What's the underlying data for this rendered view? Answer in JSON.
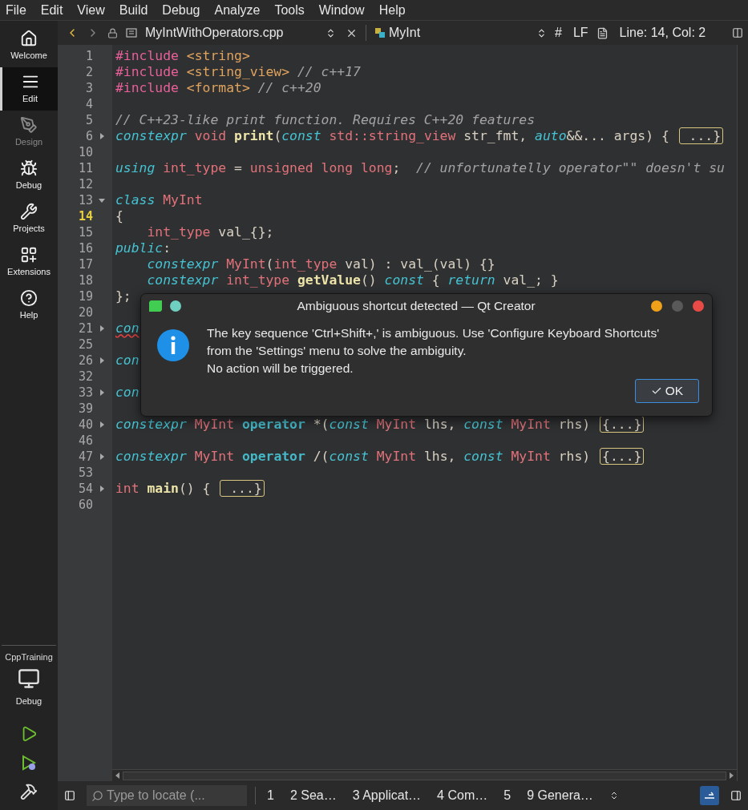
{
  "menu": [
    "File",
    "Edit",
    "View",
    "Build",
    "Debug",
    "Analyze",
    "Tools",
    "Window",
    "Help"
  ],
  "toolbar": {
    "file": "MyIntWithOperators.cpp",
    "symbol": "MyInt",
    "hash": "#",
    "line_ending": "LF",
    "position": "Line: 14, Col: 2"
  },
  "sidebar": {
    "modes": [
      {
        "label": "Welcome",
        "selected": false,
        "disabled": false
      },
      {
        "label": "Edit",
        "selected": true,
        "disabled": false
      },
      {
        "label": "Design",
        "selected": false,
        "disabled": true
      },
      {
        "label": "Debug",
        "selected": false,
        "disabled": false
      },
      {
        "label": "Projects",
        "selected": false,
        "disabled": false
      },
      {
        "label": "Extensions",
        "selected": false,
        "disabled": false
      },
      {
        "label": "Help",
        "selected": false,
        "disabled": false
      }
    ],
    "project": "CppTraining",
    "build_config": "Debug"
  },
  "editor": {
    "lines": [
      {
        "number": "1",
        "current": false,
        "tokens": [
          {
            "kind": "preproc",
            "text": "#include "
          },
          {
            "kind": "header",
            "text": "<string>"
          }
        ]
      },
      {
        "number": "2",
        "current": false,
        "tokens": [
          {
            "kind": "preproc",
            "text": "#include "
          },
          {
            "kind": "header",
            "text": "<string_view> "
          },
          {
            "kind": "comment",
            "text": "// c++17"
          }
        ]
      },
      {
        "number": "3",
        "current": false,
        "tokens": [
          {
            "kind": "preproc",
            "text": "#include "
          },
          {
            "kind": "header",
            "text": "<format> "
          },
          {
            "kind": "comment",
            "text": "// c++20"
          }
        ]
      },
      {
        "number": "4",
        "current": false
      },
      {
        "number": "5",
        "current": false,
        "tokens": [
          {
            "kind": "comment",
            "text": "// C++23-like print function. Requires C++20 features"
          }
        ]
      },
      {
        "number": "6",
        "current": false,
        "collapsed": true,
        "tokens": [
          {
            "kind": "keyword",
            "text": "constexpr "
          },
          {
            "kind": "type",
            "text": "void "
          },
          {
            "kind": "function",
            "text": "print"
          },
          {
            "kind": "plain",
            "text": "("
          },
          {
            "kind": "keyword",
            "text": "const "
          },
          {
            "kind": "type",
            "text": "std::string_view"
          },
          {
            "kind": "plain",
            "text": " str_fmt, "
          },
          {
            "kind": "keyword",
            "text": "auto"
          },
          {
            "kind": "plain",
            "text": "&&... args) { "
          },
          {
            "kind": "fold",
            "text": " ...}"
          }
        ]
      },
      {
        "number": "10",
        "current": false
      },
      {
        "number": "11",
        "current": false,
        "tokens": [
          {
            "kind": "keyword",
            "text": "using "
          },
          {
            "kind": "type",
            "text": "int_type"
          },
          {
            "kind": "plain",
            "text": " = "
          },
          {
            "kind": "type",
            "text": "unsigned long long"
          },
          {
            "kind": "plain",
            "text": ";  "
          },
          {
            "kind": "comment",
            "text": "// unfortunatelly operator\"\" doesn't su"
          }
        ]
      },
      {
        "number": "12",
        "current": false
      },
      {
        "number": "13",
        "current": false,
        "collapsed": false,
        "tokens": [
          {
            "kind": "keyword",
            "text": "class "
          },
          {
            "kind": "type",
            "text": "MyInt"
          }
        ]
      },
      {
        "number": "14",
        "current": true,
        "tokens": [
          {
            "kind": "plain",
            "text": "{"
          }
        ]
      },
      {
        "number": "15",
        "current": false,
        "tokens": [
          {
            "kind": "type",
            "text": "    int_type"
          },
          {
            "kind": "plain",
            "text": " val_{};"
          }
        ]
      },
      {
        "number": "16",
        "current": false,
        "tokens": [
          {
            "kind": "keyword",
            "text": "public"
          },
          {
            "kind": "plain",
            "text": ":"
          }
        ]
      },
      {
        "number": "17",
        "current": false,
        "tokens": [
          {
            "kind": "keyword",
            "text": "    constexpr "
          },
          {
            "kind": "type",
            "text": "MyInt"
          },
          {
            "kind": "plain",
            "text": "("
          },
          {
            "kind": "type",
            "text": "int_type"
          },
          {
            "kind": "plain",
            "text": " val) : val_(val) {}"
          }
        ]
      },
      {
        "number": "18",
        "current": false,
        "tokens": [
          {
            "kind": "keyword",
            "text": "    constexpr "
          },
          {
            "kind": "type",
            "text": "int_type "
          },
          {
            "kind": "function",
            "text": "getValue"
          },
          {
            "kind": "plain",
            "text": "() "
          },
          {
            "kind": "keyword",
            "text": "const"
          },
          {
            "kind": "plain",
            "text": " { "
          },
          {
            "kind": "keyword",
            "text": "return"
          },
          {
            "kind": "plain",
            "text": " val_; }"
          }
        ]
      },
      {
        "number": "19",
        "current": false,
        "tokens": [
          {
            "kind": "plain",
            "text": "};"
          }
        ]
      },
      {
        "number": "20",
        "current": false
      },
      {
        "number": "21",
        "current": false,
        "collapsed": true,
        "tokens": [
          {
            "kind": "error",
            "text": "con"
          }
        ]
      },
      {
        "number": "25",
        "current": false
      },
      {
        "number": "26",
        "current": false,
        "collapsed": true,
        "tokens": [
          {
            "kind": "keyword",
            "text": "con"
          }
        ]
      },
      {
        "number": "32",
        "current": false
      },
      {
        "number": "33",
        "current": false,
        "collapsed": true,
        "tokens": [
          {
            "kind": "keyword",
            "text": "con"
          }
        ]
      },
      {
        "number": "39",
        "current": false
      },
      {
        "number": "40",
        "current": false,
        "collapsed": true,
        "tokens": [
          {
            "kind": "keyword",
            "text": "constexpr "
          },
          {
            "kind": "type",
            "text": "MyInt "
          },
          {
            "kind": "operator",
            "text": "operator"
          },
          {
            "kind": "plain",
            "text": " *("
          },
          {
            "kind": "keyword",
            "text": "const "
          },
          {
            "kind": "type",
            "text": "MyInt"
          },
          {
            "kind": "plain",
            "text": " lhs, "
          },
          {
            "kind": "keyword",
            "text": "const "
          },
          {
            "kind": "type",
            "text": "MyInt"
          },
          {
            "kind": "plain",
            "text": " rhs) "
          },
          {
            "kind": "fold",
            "text": "{...}"
          }
        ]
      },
      {
        "number": "46",
        "current": false
      },
      {
        "number": "47",
        "current": false,
        "collapsed": true,
        "tokens": [
          {
            "kind": "keyword",
            "text": "constexpr "
          },
          {
            "kind": "type",
            "text": "MyInt "
          },
          {
            "kind": "operator",
            "text": "operator"
          },
          {
            "kind": "plain",
            "text": " /("
          },
          {
            "kind": "keyword",
            "text": "const "
          },
          {
            "kind": "type",
            "text": "MyInt"
          },
          {
            "kind": "plain",
            "text": " lhs, "
          },
          {
            "kind": "keyword",
            "text": "const "
          },
          {
            "kind": "type",
            "text": "MyInt"
          },
          {
            "kind": "plain",
            "text": " rhs) "
          },
          {
            "kind": "fold",
            "text": "{...}"
          }
        ]
      },
      {
        "number": "53",
        "current": false
      },
      {
        "number": "54",
        "current": false,
        "collapsed": true,
        "tokens": [
          {
            "kind": "type",
            "text": "int "
          },
          {
            "kind": "function",
            "text": "main"
          },
          {
            "kind": "plain",
            "text": "() { "
          },
          {
            "kind": "fold",
            "text": " ...}"
          }
        ]
      },
      {
        "number": "60",
        "current": false
      }
    ]
  },
  "dialog": {
    "title": "Ambiguous shortcut detected — Qt Creator",
    "message": [
      "The key sequence 'Ctrl+Shift+,' is ambiguous. Use 'Configure Keyboard Shortcuts'",
      "from the 'Settings' menu to solve the ambiguity.",
      "No action will be triggered."
    ],
    "button": "OK"
  },
  "status_bar": {
    "search": {
      "placeholder": "Type to locate (..."
    },
    "panes": [
      "1",
      "2 Sea…",
      "3 Applicat…",
      "4 Com…",
      "5",
      "9 Genera…"
    ],
    "output_shown": true
  }
}
